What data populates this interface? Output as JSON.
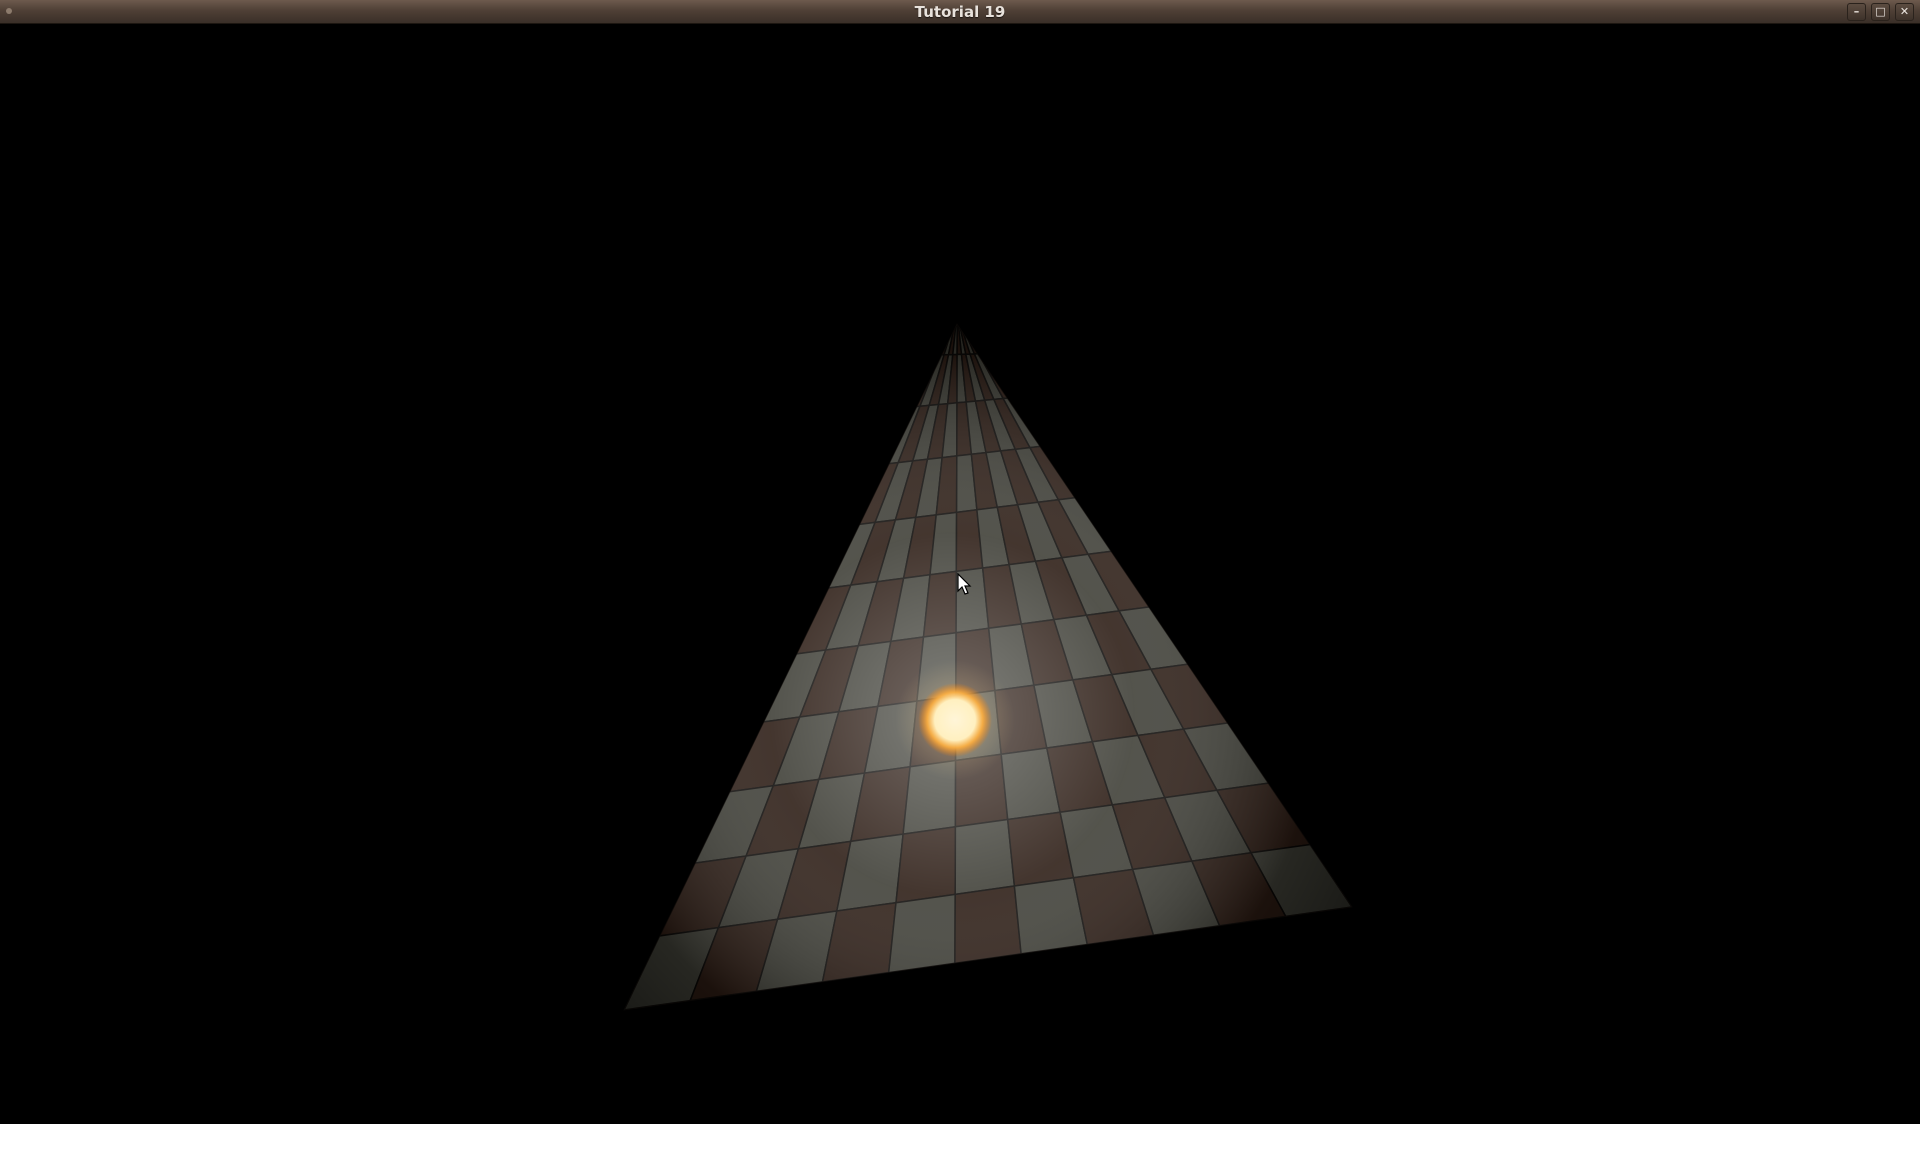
{
  "window": {
    "title": "Tutorial 19",
    "controls": {
      "minimize_label": "–",
      "maximize_label": "□",
      "close_label": "✕"
    }
  },
  "scene": {
    "object": "checkerboard-quad",
    "tile_colors": {
      "light": "#3c3c34",
      "dark": "#2a1a12",
      "seam": "#0a0806"
    },
    "light_color": "#fff5d8",
    "light_glow": "#ffb040"
  },
  "icons": {
    "cursor": "mouse-pointer-icon",
    "menu": "window-menu-icon"
  }
}
